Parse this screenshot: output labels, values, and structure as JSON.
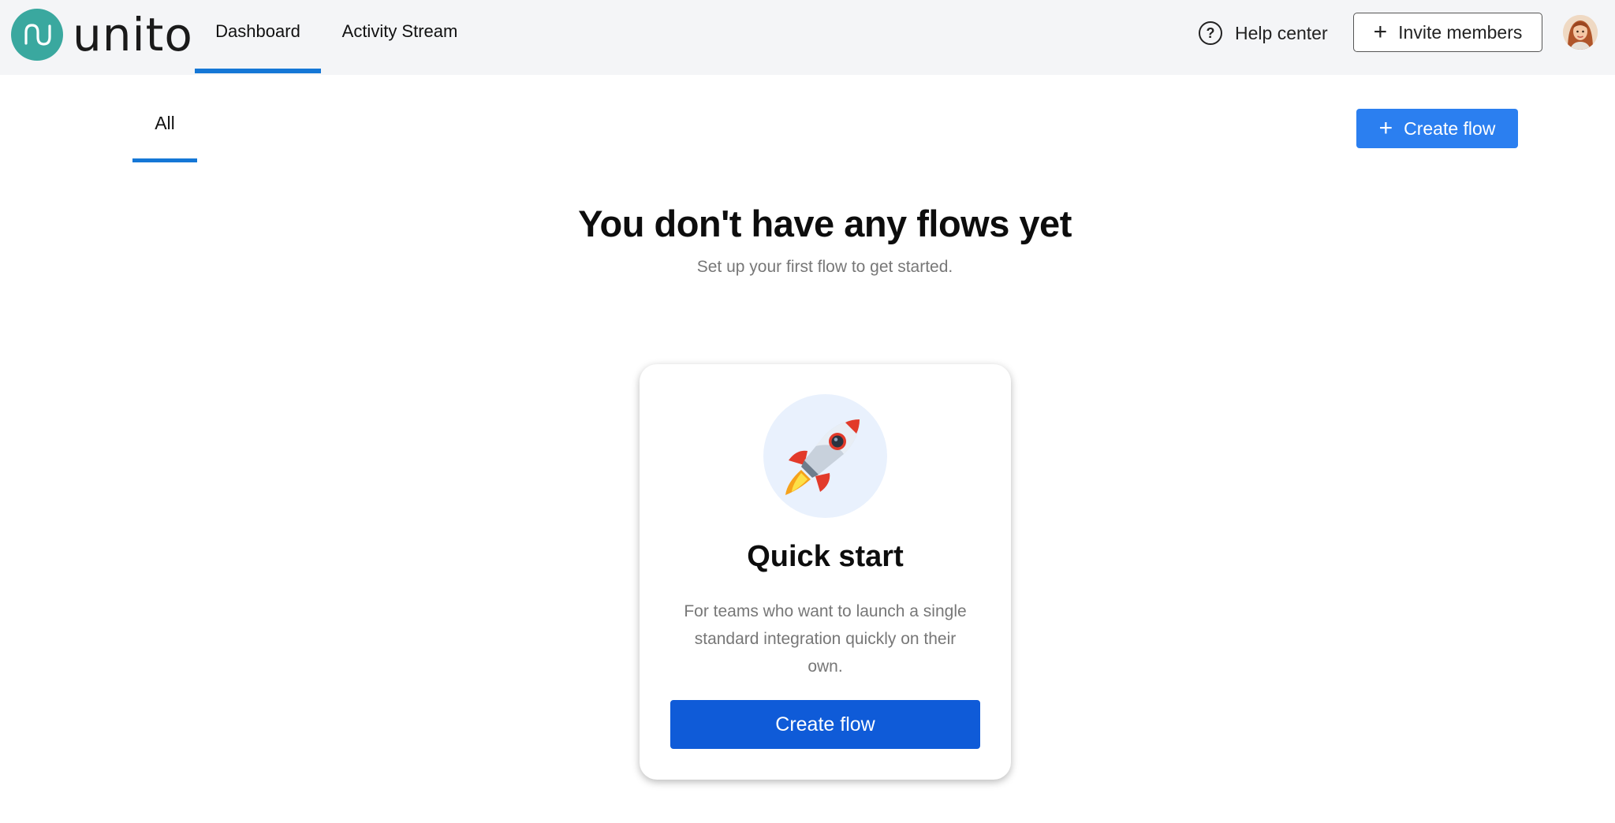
{
  "app": {
    "logo_text": "unito"
  },
  "nav": {
    "tabs": [
      {
        "label": "Dashboard",
        "active": true
      },
      {
        "label": "Activity Stream",
        "active": false
      }
    ]
  },
  "header": {
    "help_label": "Help center",
    "help_icon": "question-circle-icon",
    "invite_label": "Invite members",
    "invite_icon": "plus-icon",
    "avatar": "user-avatar"
  },
  "subheader": {
    "tab_all": "All",
    "create_label": "Create flow",
    "create_icon": "plus-icon"
  },
  "empty_state": {
    "title": "You don't have any flows yet",
    "subtitle": "Set up your first flow to get started."
  },
  "card": {
    "icon": "rocket-icon",
    "title": "Quick start",
    "description": "For teams who want to launch a single standard integration quickly on their own.",
    "button_label": "Create flow"
  },
  "colors": {
    "accent": "#1577d6",
    "primary_button": "#2b7ff0",
    "card_button": "#0f5bd8",
    "logo": "#3aa89f",
    "topbar_bg": "#f4f5f7"
  }
}
